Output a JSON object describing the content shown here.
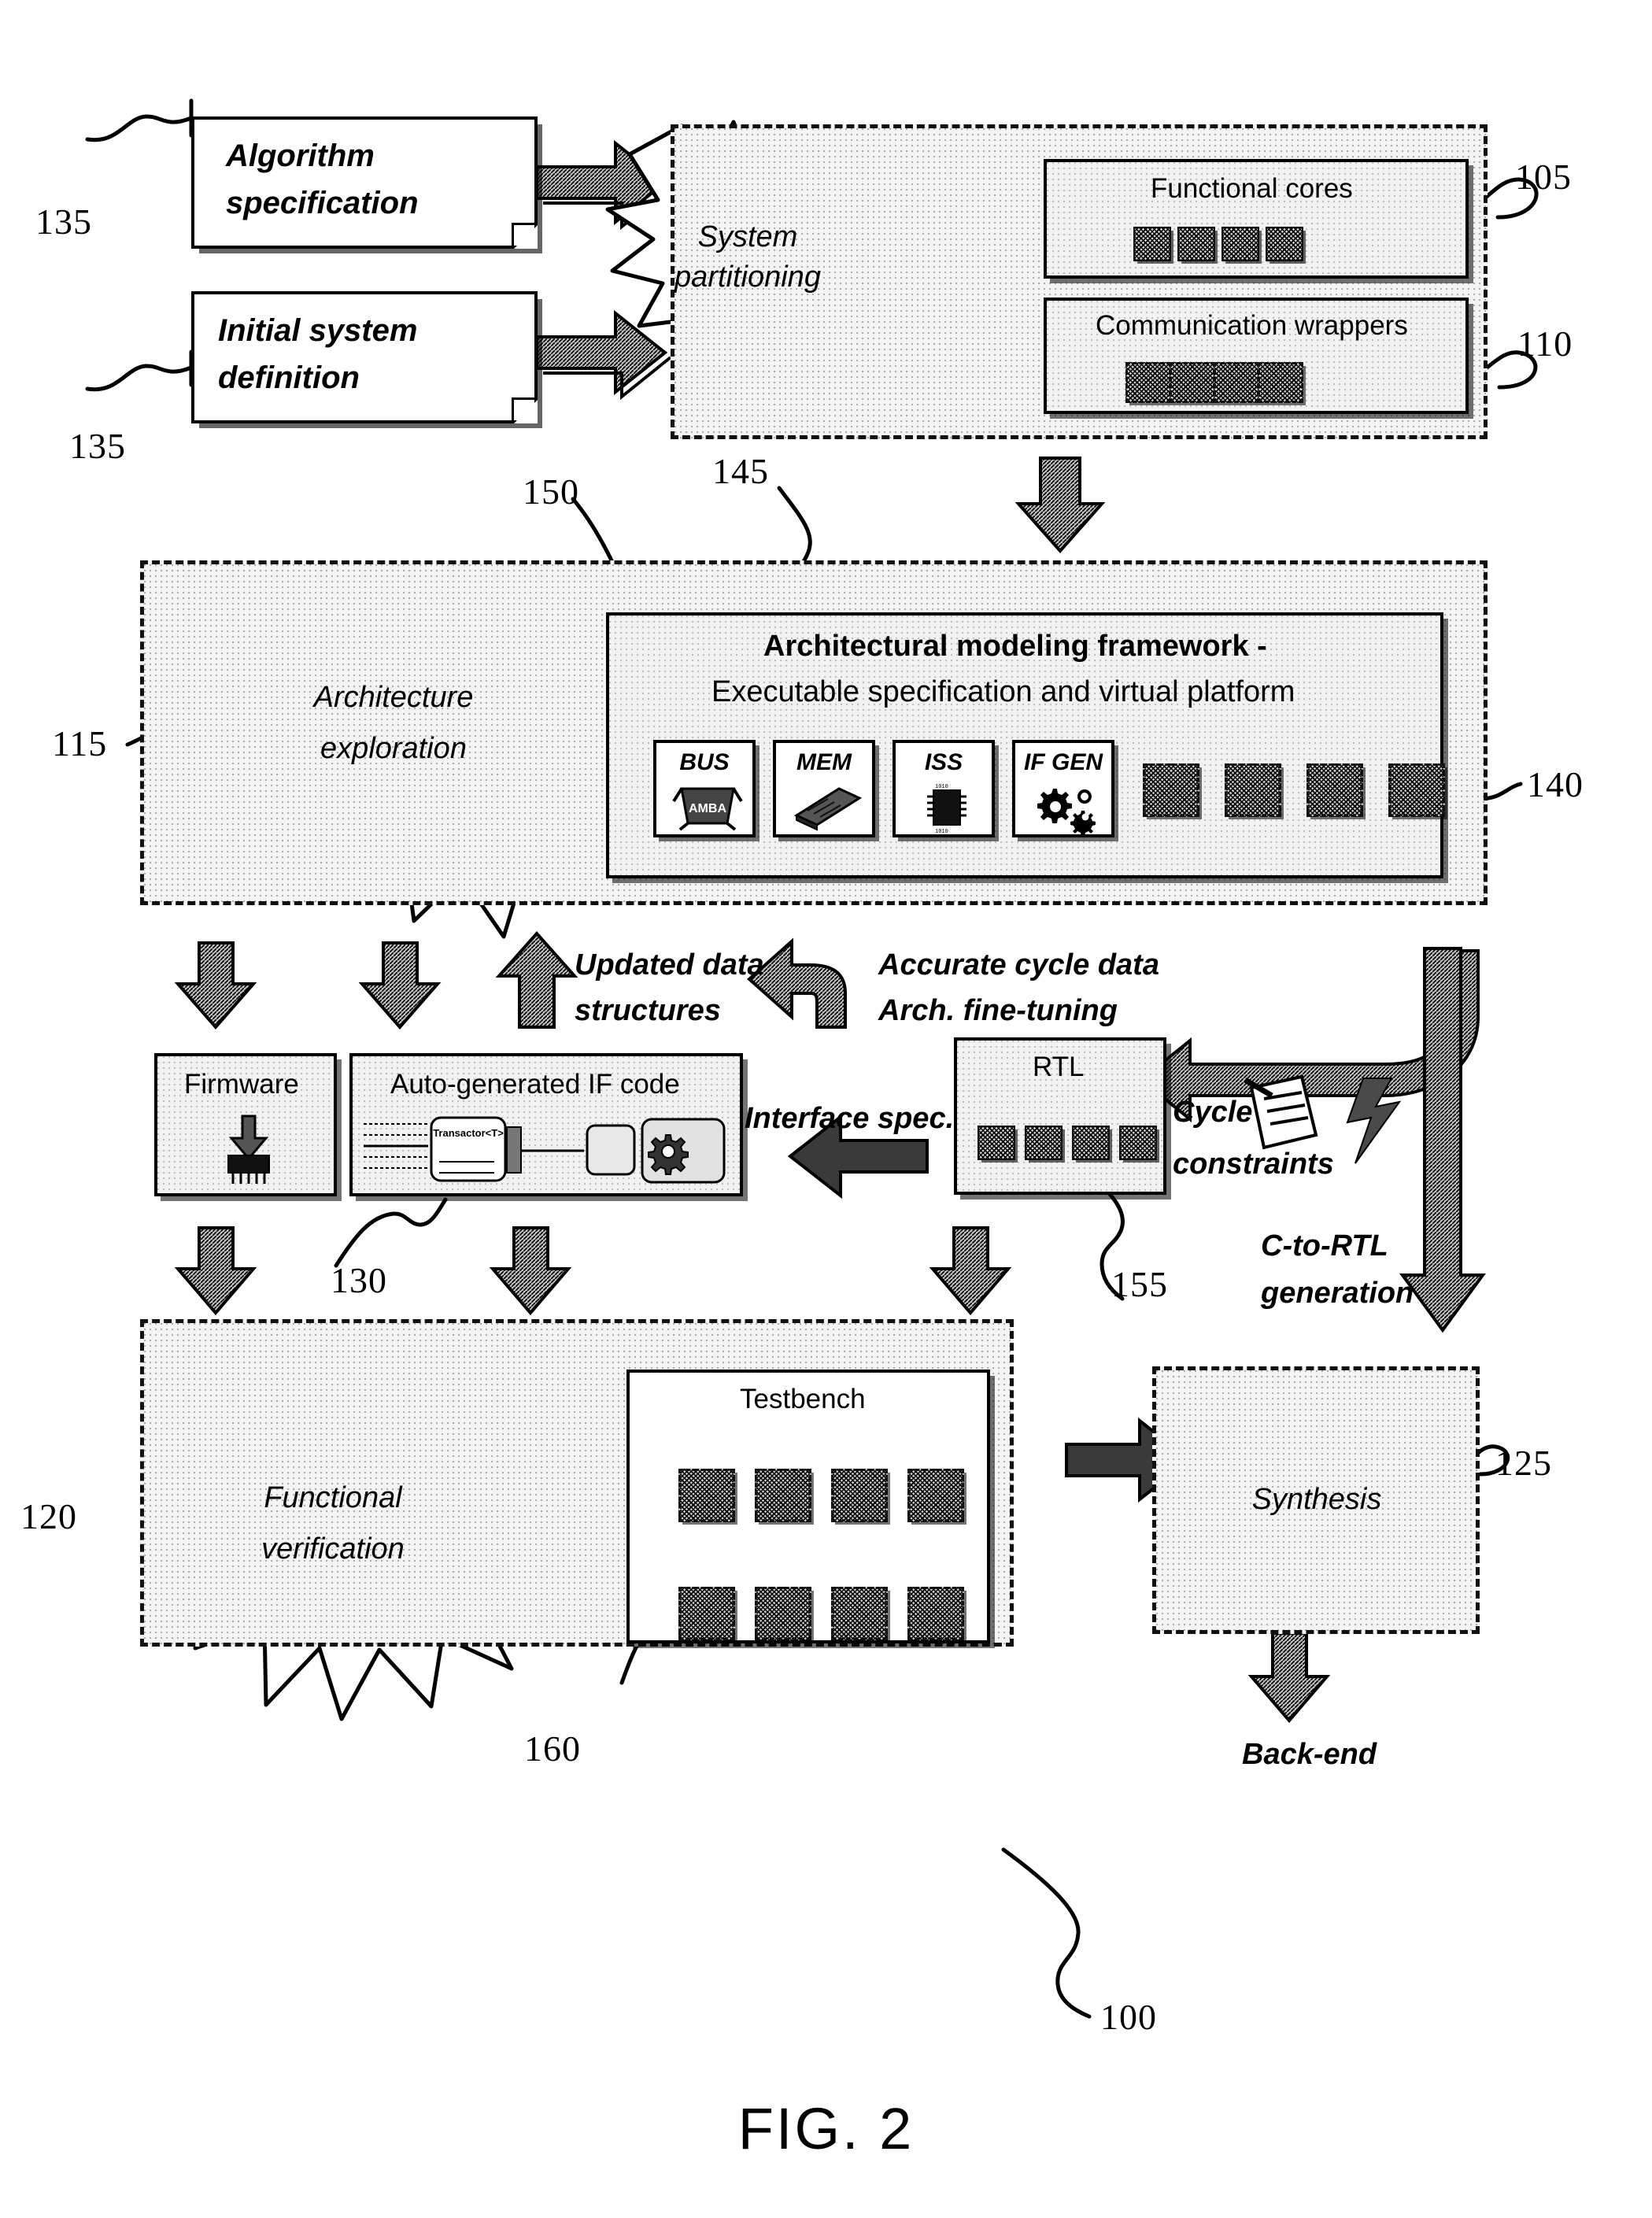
{
  "figure": {
    "caption": "FIG. 2",
    "overall_ref": "100"
  },
  "inputs": {
    "algorithm_spec": {
      "line1": "Algorithm",
      "line2": "specification",
      "ref": "135"
    },
    "initial_system": {
      "line1": "Initial system",
      "line2": "definition",
      "ref": "135"
    }
  },
  "partitioning_region": {
    "ref": "145",
    "star": {
      "line1": "System",
      "line2": "partitioning"
    },
    "functional_cores": {
      "label": "Functional cores",
      "ref": "105",
      "count": 4
    },
    "communication_wrappers": {
      "label": "Communication wrappers",
      "ref": "110",
      "count": 4
    }
  },
  "architecture_region": {
    "ref": "115",
    "star": {
      "line1": "Architecture",
      "line2": "exploration"
    },
    "framework": {
      "ref": "150",
      "title_line1": "Architectural modeling framework -",
      "title_line2": "Executable specification and virtual platform",
      "tools": [
        {
          "label": "BUS",
          "icon": "amba-bus-icon"
        },
        {
          "label": "MEM",
          "icon": "memory-chip-icon"
        },
        {
          "label": "ISS",
          "icon": "processor-chip-icon"
        },
        {
          "label": "IF GEN",
          "icon": "gears-icon"
        }
      ],
      "chain_ref": "140",
      "chain_count": 4
    }
  },
  "middle_row": {
    "firmware": {
      "label": "Firmware",
      "icon": "chip-download-icon"
    },
    "auto_if_code": {
      "label": "Auto-generated IF code",
      "ref": "130",
      "code_snippet": "Transactor<T>"
    },
    "rtl": {
      "label": "RTL",
      "ref": "155",
      "block_count": 4
    },
    "arrow_labels": {
      "updated_data": {
        "line1": "Updated data",
        "line2": "structures"
      },
      "accurate_cycle": {
        "line1": "Accurate cycle data",
        "line2": "Arch. fine-tuning"
      },
      "interface_spec": "Interface spec.",
      "cycle_constraints": {
        "line1": "Cycle",
        "line2": "constraints"
      },
      "c_to_rtl": {
        "line1": "C-to-RTL",
        "line2": "generation"
      }
    }
  },
  "verification_region": {
    "ref": "120",
    "star": {
      "line1": "Functional",
      "line2": "verification"
    },
    "testbench": {
      "label": "Testbench",
      "ref": "160",
      "pair_count": 4
    }
  },
  "synthesis_region": {
    "ref": "125",
    "star": {
      "line1": "Synthesis"
    },
    "output_label": "Back-end"
  },
  "colors": {
    "ink": "#000000",
    "region_fill": "#f4f4f4",
    "box_fill": "#f2f2f2"
  }
}
